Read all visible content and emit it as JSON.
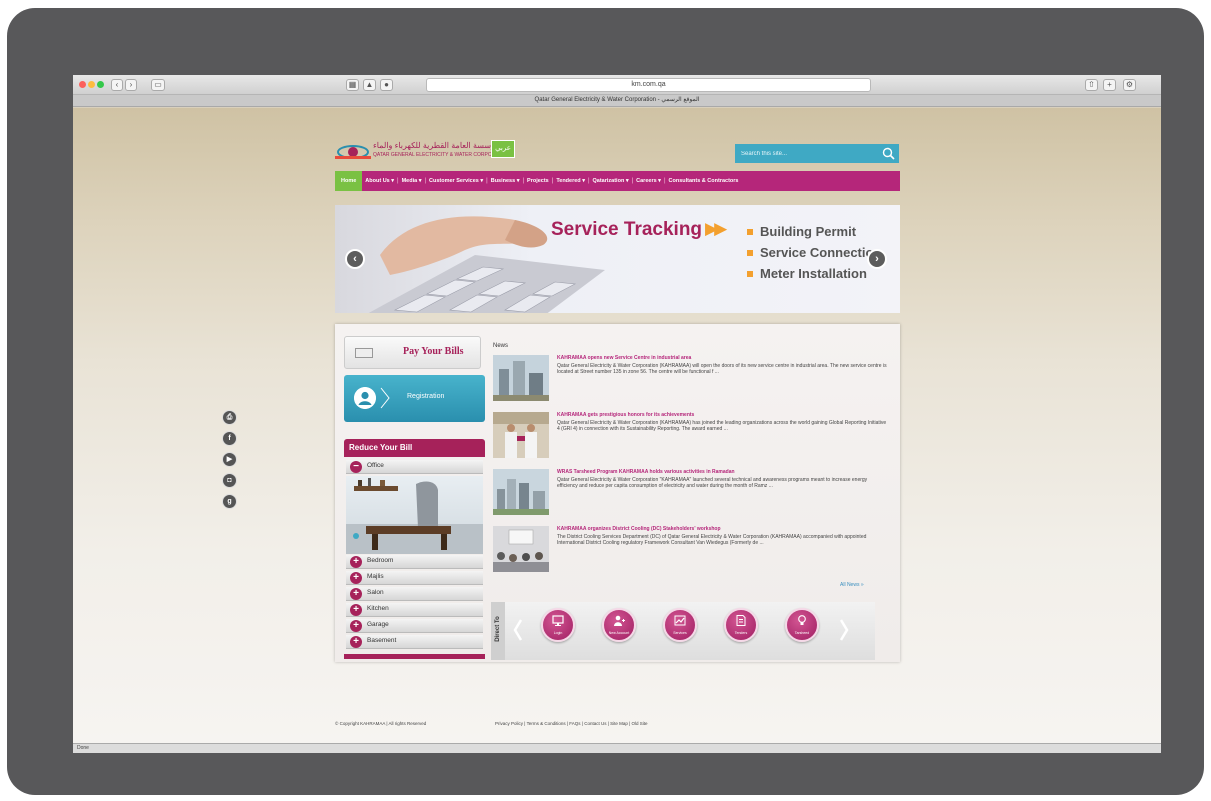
{
  "browser": {
    "url": "km.com.qa",
    "tab_title": "Qatar General Electricity & Water Corporation - الموقع الرسمي",
    "status": "Done"
  },
  "header": {
    "logo_arabic": "المؤسسة العامة القطرية للكهرباء والماء",
    "logo_english": "QATAR GENERAL ELECTRICITY & WATER CORPORATION",
    "lang_button": "عربي",
    "search_placeholder": "Search this site..."
  },
  "nav": {
    "items": [
      "Home",
      "About Us ▾",
      "Media ▾",
      "Customer Services ▾",
      "Business ▾",
      "Projects",
      "Tendered ▾",
      "Qatarization ▾",
      "Careers ▾",
      "Consultants & Contractors"
    ]
  },
  "slider": {
    "title": "Service Tracking",
    "bullets": [
      "Building Permit",
      "Service Connection",
      "Meter Installation"
    ]
  },
  "sidebar": {
    "pay_bills": "Pay Your Bills",
    "registration": "Registration",
    "reduce_bill_title": "Reduce Your Bill",
    "rooms": [
      "Office",
      "Bedroom",
      "Majlis",
      "Salon",
      "Kitchen",
      "Garage",
      "Basement"
    ]
  },
  "news": {
    "heading": "News",
    "items": [
      {
        "title": "KAHRAMAA opens new Service Centre in industrial area",
        "body": "Qatar General Electricity & Water Corporation (KAHRAMAA) will open the doors of its new service centre in industrial area. The new service centre is located at Street number 135 in zone 56. The centre will be functional f ..."
      },
      {
        "title": "KAHRAMAA gets prestigious honors for its achievements",
        "body": "Qatar General Electricity & Water Corporation (KAHRAMAA) has joined the leading organizations across the world gaining Global Reporting Initiative 4 (GRI 4) in connection with its Sustainability Reporting. The award earned ..."
      },
      {
        "title": "WRAS Tarsheed Program KAHRAMAA holds various activities in Ramadan",
        "body": "Qatar General Electricity & Water Corporation \"KAHRAMAA\" launched several technical and awareness programs meant to increase energy efficiency and reduce per capita consumption of electricity and water during the month of Ramz ..."
      },
      {
        "title": "KAHRAMAA organizes District Cooling (DC) Stakeholders' workshop",
        "body": "The District Cooling Services Department (DC) of Qatar General Electricity & Water Corporation (KAHRAMAA) accompanied with appointed International District Cooling regulatory Framework Consultant Van Wiedegus (Formerly de ..."
      }
    ],
    "all_news": "All News »"
  },
  "quick_links": {
    "tab_label": "Direct To",
    "items": [
      {
        "label": "Login",
        "icon": "monitor-icon"
      },
      {
        "label": "New Account",
        "icon": "user-add-icon"
      },
      {
        "label": "Services",
        "icon": "chart-icon"
      },
      {
        "label": "Tenders",
        "icon": "document-icon"
      },
      {
        "label": "Tarsheed",
        "icon": "bulb-icon"
      }
    ]
  },
  "social": [
    "print-icon",
    "facebook-icon",
    "youtube-icon",
    "instagram-icon",
    "googleplus-icon"
  ],
  "footer": {
    "copyright": "© Copyright KAHRAMAA | All rights Reserved",
    "links": "Privacy Policy | Terms & Conditions | FAQs | Contact Us | Site Map | Old Site"
  },
  "colors": {
    "brand_magenta": "#a6225a",
    "nav_magenta": "#b5267a",
    "accent_green": "#7ac143",
    "accent_blue": "#3fa9c4",
    "accent_orange": "#f3a02e"
  }
}
